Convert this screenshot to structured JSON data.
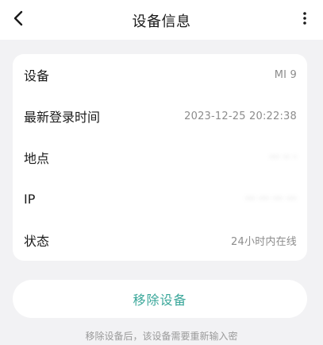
{
  "header": {
    "title": "设备信息",
    "back_icon": "chevron-left-icon",
    "more_icon": "more-vertical-icon"
  },
  "device_info": {
    "rows": [
      {
        "label": "设备",
        "value": "MI 9"
      },
      {
        "label": "最新登录时间",
        "value": "2023-12-25 20:22:38"
      },
      {
        "label": "地点",
        "value": "··· ·· ·"
      },
      {
        "label": "IP",
        "value": "··· ··· ··· ···"
      },
      {
        "label": "状态",
        "value": "24小时内在线"
      }
    ]
  },
  "actions": {
    "remove_label": "移除设备",
    "remove_hint": "移除设备后，该设备需要重新输入密"
  },
  "colors": {
    "accent": "#3aa79a",
    "background": "#f2f2f4",
    "card": "#ffffff",
    "secondary_text": "#8c8c8c"
  }
}
